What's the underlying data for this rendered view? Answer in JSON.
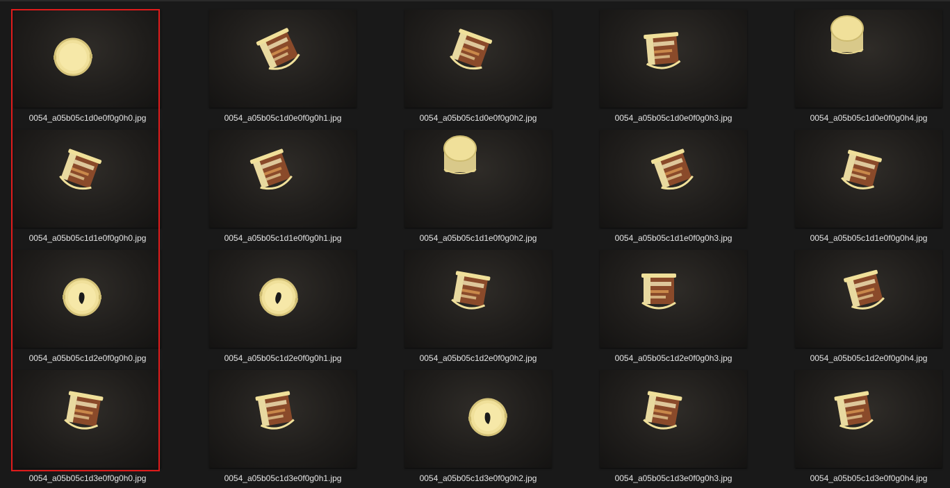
{
  "files": [
    {
      "name": "0054_a05b05c1d0e0f0g0h0.jpg",
      "icon": "cup-top-view"
    },
    {
      "name": "0054_a05b05c1d0e0f0g0h1.jpg",
      "icon": "cup-side-label"
    },
    {
      "name": "0054_a05b05c1d0e0f0g0h2.jpg",
      "icon": "cup-side-label"
    },
    {
      "name": "0054_a05b05c1d0e0f0g0h3.jpg",
      "icon": "cup-side-label"
    },
    {
      "name": "0054_a05b05c1d0e0f0g0h4.jpg",
      "icon": "cup-bottom-view"
    },
    {
      "name": "0054_a05b05c1d1e0f0g0h0.jpg",
      "icon": "cup-side-label"
    },
    {
      "name": "0054_a05b05c1d1e0f0g0h1.jpg",
      "icon": "cup-side-label"
    },
    {
      "name": "0054_a05b05c1d1e0f0g0h2.jpg",
      "icon": "cup-bottom-view"
    },
    {
      "name": "0054_a05b05c1d1e0f0g0h3.jpg",
      "icon": "cup-side-label"
    },
    {
      "name": "0054_a05b05c1d1e0f0g0h4.jpg",
      "icon": "cup-side-label"
    },
    {
      "name": "0054_a05b05c1d2e0f0g0h0.jpg",
      "icon": "cup-top-view"
    },
    {
      "name": "0054_a05b05c1d2e0f0g0h1.jpg",
      "icon": "cup-top-view"
    },
    {
      "name": "0054_a05b05c1d2e0f0g0h2.jpg",
      "icon": "cup-side-label"
    },
    {
      "name": "0054_a05b05c1d2e0f0g0h3.jpg",
      "icon": "cup-side-label"
    },
    {
      "name": "0054_a05b05c1d2e0f0g0h4.jpg",
      "icon": "cup-side-label"
    },
    {
      "name": "0054_a05b05c1d3e0f0g0h0.jpg",
      "icon": "cup-side-label"
    },
    {
      "name": "0054_a05b05c1d3e0f0g0h1.jpg",
      "icon": "cup-side-label"
    },
    {
      "name": "0054_a05b05c1d3e0f0g0h2.jpg",
      "icon": "cup-top-view"
    },
    {
      "name": "0054_a05b05c1d3e0f0g0h3.jpg",
      "icon": "cup-side-label"
    },
    {
      "name": "0054_a05b05c1d3e0f0g0h4.jpg",
      "icon": "cup-side-label"
    }
  ],
  "colors": {
    "background": "#191919",
    "selection_border": "#e01b1b",
    "caption_text": "#e6e6e6",
    "cup_body": "#f0e09a",
    "label_brown": "#8a4a2a"
  }
}
